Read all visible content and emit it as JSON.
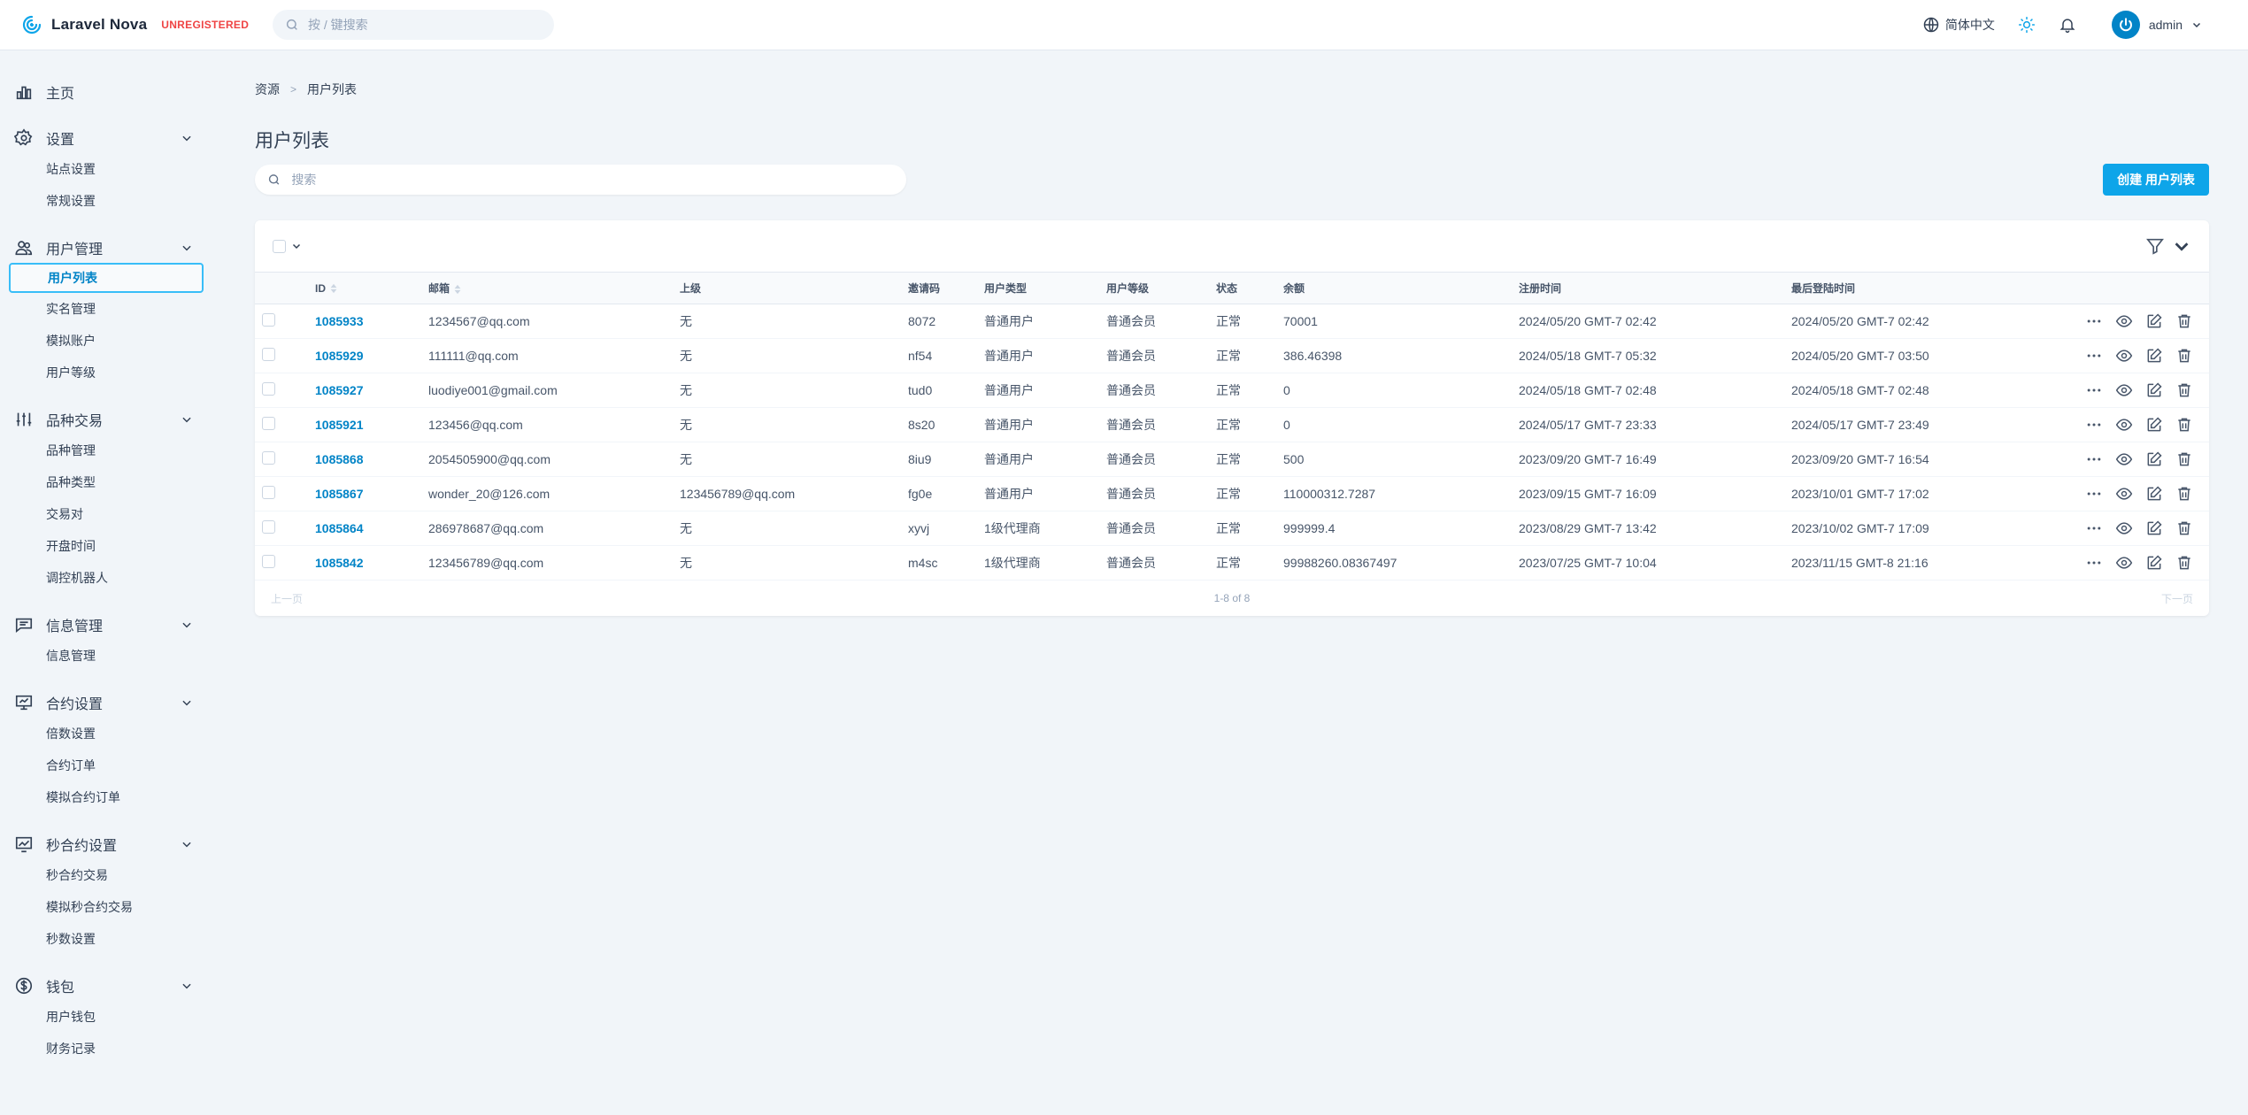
{
  "header": {
    "brand": "Laravel Nova",
    "badge": "UNREGISTERED",
    "search_placeholder": "按 / 键搜索",
    "language": "简体中文",
    "user": "admin"
  },
  "sidebar": {
    "groups": [
      {
        "label": "主页",
        "icon": "chart-icon",
        "items": []
      },
      {
        "label": "设置",
        "icon": "gear-icon",
        "items": [
          "站点设置",
          "常规设置"
        ]
      },
      {
        "label": "用户管理",
        "icon": "users-icon",
        "items": [
          "用户列表",
          "实名管理",
          "模拟账户",
          "用户等级"
        ]
      },
      {
        "label": "品种交易",
        "icon": "sliders-icon",
        "items": [
          "品种管理",
          "品种类型",
          "交易对",
          "开盘时间",
          "调控机器人"
        ]
      },
      {
        "label": "信息管理",
        "icon": "message-icon",
        "items": [
          "信息管理"
        ]
      },
      {
        "label": "合约设置",
        "icon": "presentation-icon",
        "items": [
          "倍数设置",
          "合约订单",
          "模拟合约订单"
        ]
      },
      {
        "label": "秒合约设置",
        "icon": "trend-icon",
        "items": [
          "秒合约交易",
          "模拟秒合约交易",
          "秒数设置"
        ]
      },
      {
        "label": "钱包",
        "icon": "dollar-icon",
        "items": [
          "用户钱包",
          "财务记录"
        ]
      }
    ],
    "active": "用户列表"
  },
  "breadcrumb": {
    "root": "资源",
    "current": "用户列表"
  },
  "page": {
    "title": "用户列表",
    "search_placeholder": "搜索",
    "create_label": "创建 用户列表"
  },
  "table": {
    "columns": [
      "ID",
      "邮箱",
      "上级",
      "邀请码",
      "用户类型",
      "用户等级",
      "状态",
      "余额",
      "注册时间",
      "最后登陆时间"
    ],
    "rows": [
      [
        "1085933",
        "1234567@qq.com",
        "无",
        "8072",
        "普通用户",
        "普通会员",
        "正常",
        "70001",
        "2024/05/20 GMT-7 02:42",
        "2024/05/20 GMT-7 02:42"
      ],
      [
        "1085929",
        "111111@qq.com",
        "无",
        "nf54",
        "普通用户",
        "普通会员",
        "正常",
        "386.46398",
        "2024/05/18 GMT-7 05:32",
        "2024/05/20 GMT-7 03:50"
      ],
      [
        "1085927",
        "luodiye001@gmail.com",
        "无",
        "tud0",
        "普通用户",
        "普通会员",
        "正常",
        "0",
        "2024/05/18 GMT-7 02:48",
        "2024/05/18 GMT-7 02:48"
      ],
      [
        "1085921",
        "123456@qq.com",
        "无",
        "8s20",
        "普通用户",
        "普通会员",
        "正常",
        "0",
        "2024/05/17 GMT-7 23:33",
        "2024/05/17 GMT-7 23:49"
      ],
      [
        "1085868",
        "2054505900@qq.com",
        "无",
        "8iu9",
        "普通用户",
        "普通会员",
        "正常",
        "500",
        "2023/09/20 GMT-7 16:49",
        "2023/09/20 GMT-7 16:54"
      ],
      [
        "1085867",
        "wonder_20@126.com",
        "123456789@qq.com",
        "fg0e",
        "普通用户",
        "普通会员",
        "正常",
        "110000312.7287",
        "2023/09/15 GMT-7 16:09",
        "2023/10/01 GMT-7 17:02"
      ],
      [
        "1085864",
        "286978687@qq.com",
        "无",
        "xyvj",
        "1级代理商",
        "普通会员",
        "正常",
        "999999.4",
        "2023/08/29 GMT-7 13:42",
        "2023/10/02 GMT-7 17:09"
      ],
      [
        "1085842",
        "123456789@qq.com",
        "无",
        "m4sc",
        "1级代理商",
        "普通会员",
        "正常",
        "99988260.08367497",
        "2023/07/25 GMT-7 10:04",
        "2023/11/15 GMT-8 21:16"
      ]
    ]
  },
  "pagination": {
    "prev": "上一页",
    "info": "1-8 of 8",
    "next": "下一页"
  }
}
